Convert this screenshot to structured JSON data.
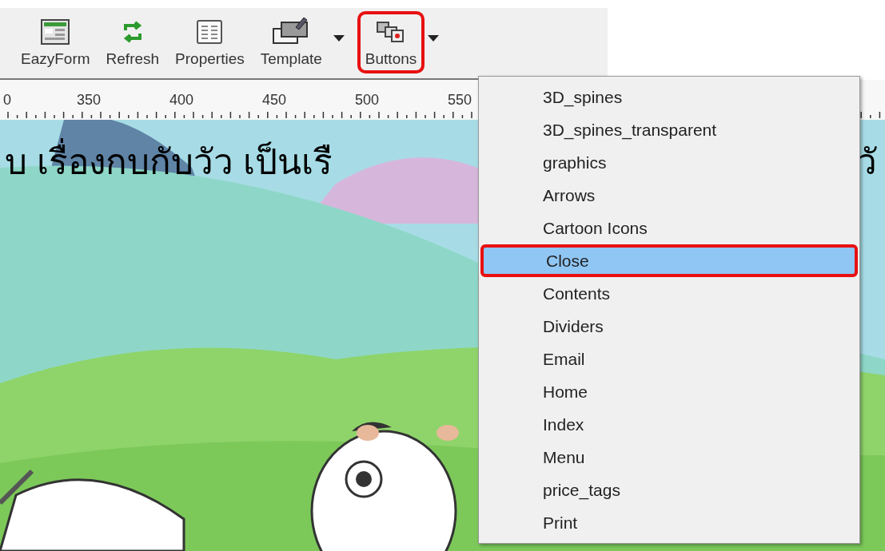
{
  "toolbar": {
    "items": [
      {
        "label": "EazyForm",
        "kind": "form",
        "dropdown": false,
        "highlighted": false
      },
      {
        "label": "Refresh",
        "kind": "refresh",
        "dropdown": false,
        "highlighted": false
      },
      {
        "label": "Properties",
        "kind": "properties",
        "dropdown": false,
        "highlighted": false
      },
      {
        "label": "Template",
        "kind": "template",
        "dropdown": true,
        "highlighted": false
      },
      {
        "label": "Buttons",
        "kind": "buttons",
        "dropdown": true,
        "highlighted": true
      }
    ]
  },
  "ruler": {
    "labels": [
      "0",
      "350",
      "400",
      "450",
      "500",
      "550"
    ]
  },
  "canvas": {
    "title_left": "บ เรื่องกบกับวัว เป็นเรื",
    "title_right": "วั"
  },
  "menu": {
    "items": [
      {
        "label": "3D_spines",
        "selected": false
      },
      {
        "label": "3D_spines_transparent",
        "selected": false
      },
      {
        "label": "graphics",
        "selected": false
      },
      {
        "label": "Arrows",
        "selected": false
      },
      {
        "label": "Cartoon Icons",
        "selected": false
      },
      {
        "label": "Close",
        "selected": true
      },
      {
        "label": "Contents",
        "selected": false
      },
      {
        "label": "Dividers",
        "selected": false
      },
      {
        "label": "Email",
        "selected": false
      },
      {
        "label": "Home",
        "selected": false
      },
      {
        "label": "Index",
        "selected": false
      },
      {
        "label": "Menu",
        "selected": false
      },
      {
        "label": "price_tags",
        "selected": false
      },
      {
        "label": "Print",
        "selected": false
      }
    ]
  }
}
